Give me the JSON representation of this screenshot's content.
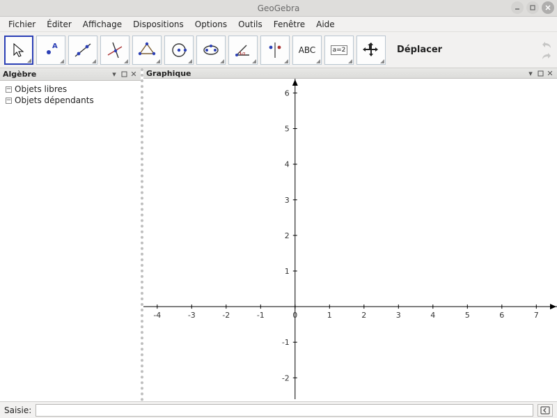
{
  "titlebar": {
    "title": "GeoGebra"
  },
  "menubar": {
    "items": [
      "Fichier",
      "Éditer",
      "Affichage",
      "Dispositions",
      "Options",
      "Outils",
      "Fenêtre",
      "Aide"
    ]
  },
  "toolbar": {
    "label": "Déplacer",
    "icons": {
      "text_button": "ABC",
      "slider_button": "a=2"
    }
  },
  "panels": {
    "algebra": {
      "title": "Algèbre",
      "tree": {
        "free": "Objets libres",
        "dependent": "Objets dépendants"
      }
    },
    "graphics": {
      "title": "Graphique"
    }
  },
  "chart_data": {
    "type": "scatter",
    "series": [],
    "xlabel": "",
    "ylabel": "",
    "xlim": [
      -4.4,
      7.6
    ],
    "ylim": [
      -2.6,
      6.4
    ],
    "xticks": [
      -4,
      -3,
      -2,
      -1,
      0,
      1,
      2,
      3,
      4,
      5,
      6,
      7
    ],
    "yticks": [
      -2,
      -1,
      0,
      1,
      2,
      3,
      4,
      5,
      6
    ]
  },
  "inputbar": {
    "label": "Saisie:",
    "value": ""
  }
}
